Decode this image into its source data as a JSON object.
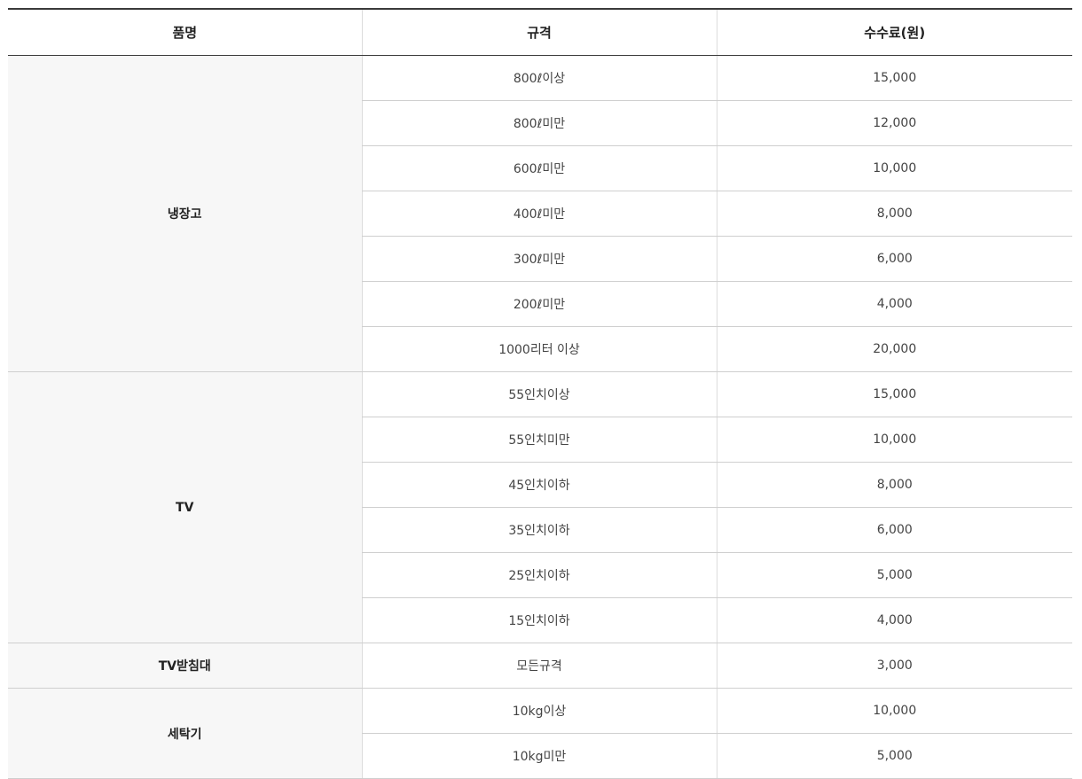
{
  "table": {
    "headers": {
      "item": "품명",
      "spec": "규격",
      "fee": "수수료(원)"
    },
    "groups": [
      {
        "item": "냉장고",
        "rows": [
          {
            "spec": "800ℓ이상",
            "fee": "15,000"
          },
          {
            "spec": "800ℓ미만",
            "fee": "12,000"
          },
          {
            "spec": "600ℓ미만",
            "fee": "10,000"
          },
          {
            "spec": "400ℓ미만",
            "fee": "8,000"
          },
          {
            "spec": "300ℓ미만",
            "fee": "6,000"
          },
          {
            "spec": "200ℓ미만",
            "fee": "4,000"
          },
          {
            "spec": "1000리터 이상",
            "fee": "20,000"
          }
        ]
      },
      {
        "item": "TV",
        "rows": [
          {
            "spec": "55인치이상",
            "fee": "15,000"
          },
          {
            "spec": "55인치미만",
            "fee": "10,000"
          },
          {
            "spec": "45인치이하",
            "fee": "8,000"
          },
          {
            "spec": "35인치이하",
            "fee": "6,000"
          },
          {
            "spec": "25인치이하",
            "fee": "5,000"
          },
          {
            "spec": "15인치이하",
            "fee": "4,000"
          }
        ]
      },
      {
        "item": "TV받침대",
        "rows": [
          {
            "spec": "모든규격",
            "fee": "3,000"
          }
        ]
      },
      {
        "item": "세탁기",
        "rows": [
          {
            "spec": "10kg이상",
            "fee": "10,000"
          },
          {
            "spec": "10kg미만",
            "fee": "5,000"
          }
        ]
      }
    ]
  }
}
